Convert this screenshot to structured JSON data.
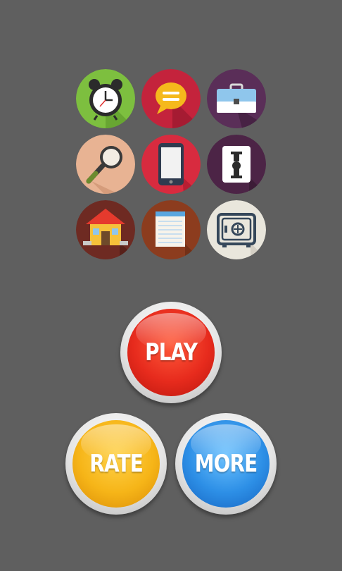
{
  "icons": [
    {
      "name": "alarm-clock-icon",
      "bg": "#7dbf3f"
    },
    {
      "name": "chat-bubble-icon",
      "bg": "#c4233c"
    },
    {
      "name": "briefcase-icon",
      "bg": "#5a2e58"
    },
    {
      "name": "magnifier-icon",
      "bg": "#e8b393"
    },
    {
      "name": "smartphone-icon",
      "bg": "#d82b3f"
    },
    {
      "name": "mail-slot-icon",
      "bg": "#4c2446"
    },
    {
      "name": "house-icon",
      "bg": "#6e2a22"
    },
    {
      "name": "notepad-icon",
      "bg": "#8c3c1e"
    },
    {
      "name": "safe-icon",
      "bg": "#e9e6dc"
    }
  ],
  "buttons": {
    "play": {
      "label": "PLAY",
      "color": "#e72b1d"
    },
    "rate": {
      "label": "RATE",
      "color": "#f6b518"
    },
    "more": {
      "label": "MORE",
      "color": "#2d8fe6"
    }
  }
}
